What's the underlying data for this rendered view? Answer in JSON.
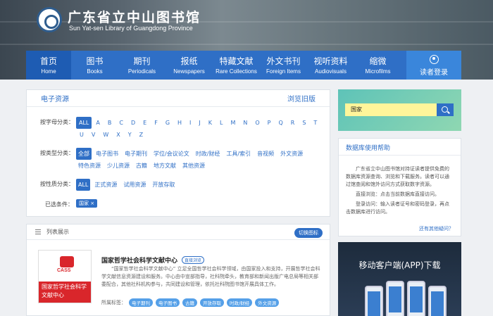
{
  "header": {
    "library_cn": "广东省立中山图书馆",
    "library_en": "Sun Yat-sen Library of Guangdong Province",
    "nav": [
      {
        "cn": "首页",
        "en": "Home"
      },
      {
        "cn": "图书",
        "en": "Books"
      },
      {
        "cn": "期刊",
        "en": "Periodicals"
      },
      {
        "cn": "报纸",
        "en": "Newspapers"
      },
      {
        "cn": "特藏文献",
        "en": "Rare Collections"
      },
      {
        "cn": "外文书刊",
        "en": "Foreign Items"
      },
      {
        "cn": "视听资料",
        "en": "Audiovisuals"
      },
      {
        "cn": "缩微",
        "en": "Microfilms"
      }
    ],
    "login_label": "读者登录"
  },
  "filter": {
    "title": "电子资源",
    "old_version": "浏览旧版",
    "alpha_label": "按字母分类：",
    "alpha": [
      "ALL",
      "A",
      "B",
      "C",
      "D",
      "E",
      "F",
      "G",
      "H",
      "I",
      "J",
      "K",
      "L",
      "M",
      "N",
      "O",
      "P",
      "Q",
      "R",
      "S",
      "T",
      "U",
      "V",
      "W",
      "X",
      "Y",
      "Z"
    ],
    "type_label": "按类型分类：",
    "types": [
      "全部",
      "电子图书",
      "电子期刊",
      "学位/会议论文",
      "时政/财经",
      "工具/索引",
      "音视频",
      "外文资源",
      "特色资源",
      "少儿资源",
      "古籍",
      "地方文献",
      "其他资源"
    ],
    "nature_label": "按性质分类：",
    "natures": [
      "ALL",
      "正式资源",
      "试用资源",
      "开放存取"
    ],
    "selected_label": "已选条件：",
    "selected_tag": "国家 ×"
  },
  "list": {
    "title": "列表展示",
    "switch_label": "切换图标",
    "item": {
      "logo_mark": "CASS",
      "logo_text": "国家哲学社会科学文献中心",
      "title": "国家哲学社会科学文献中心",
      "badge": "直接浏览",
      "desc": "“国家哲学社会科学文献中心” 立足全国哲学社会科学领域，由国家投入和支持，开展哲学社会科学文献信息资源建设和服务。中心由中宣部指导，社科院牵头，教育部和新闻出版广电总局等相关部委配合，其他社科机构参与，共同建设和管理，依托社科院图书馆开展具体工作。",
      "tags_label": "所属标签：",
      "tags": [
        "电子期刊",
        "电子图书",
        "古籍",
        "开放存取",
        "时政/财经",
        "外文资源"
      ]
    }
  },
  "search": {
    "value": "国家"
  },
  "help": {
    "title": "数据库使用帮助",
    "p1": "广东省立中山图书馆对持证读者提供免费的数据库资源查询、浏览和下载服务。读者可以通过馆查阅和馆外访问方式获取数字资源。",
    "p2": "直接浏览：点击当前数据库直接访问。",
    "p3": "登录访问：输入读者证号和密码登录，再点击数据库进行访问。",
    "more": "还有其他疑问？"
  },
  "app": {
    "title": "移动客户端(APP)下载"
  },
  "colors": {
    "primary": "#2f6fc6",
    "cass_red": "#d9262b"
  }
}
